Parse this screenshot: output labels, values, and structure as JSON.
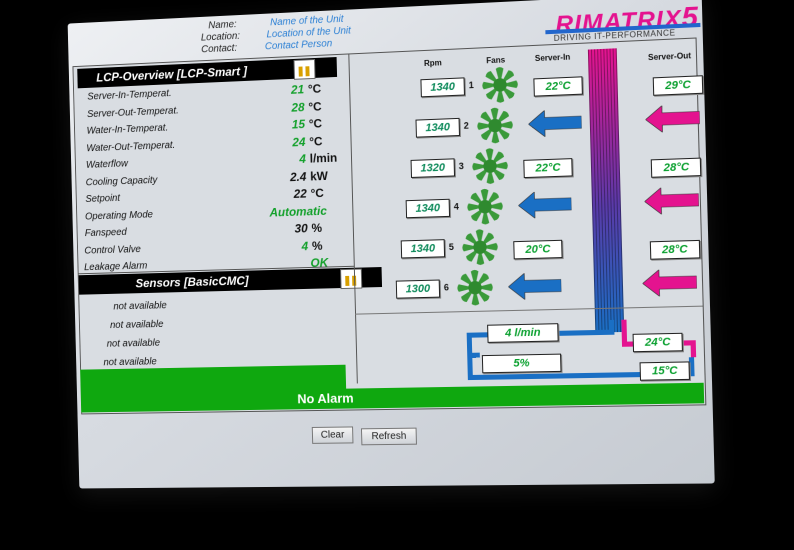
{
  "header": {
    "name_label": "Name:",
    "name_value": "Name of the Unit",
    "location_label": "Location:",
    "location_value": "Location of the Unit",
    "contact_label": "Contact:",
    "contact_value": "Contact Person",
    "logo_text": "RIMATRIX",
    "logo_suffix": "5",
    "tagline": "DRIVING IT-PERFORMANCE"
  },
  "overview": {
    "title": "LCP-Overview [LCP-Smart ]",
    "rows": [
      {
        "label": "Server-In-Temperat.",
        "value": "21",
        "unit": "°C",
        "color": "green"
      },
      {
        "label": "Server-Out-Temperat.",
        "value": "28",
        "unit": "°C",
        "color": "green"
      },
      {
        "label": "Water-In-Temperat.",
        "value": "15",
        "unit": "°C",
        "color": "green"
      },
      {
        "label": "Water-Out-Temperat.",
        "value": "24",
        "unit": "°C",
        "color": "green"
      },
      {
        "label": "Waterflow",
        "value": "4",
        "unit": "l/min",
        "color": "green"
      },
      {
        "label": "Cooling Capacity",
        "value": "2.4",
        "unit": "kW",
        "color": "black"
      },
      {
        "label": "Setpoint",
        "value": "22",
        "unit": "°C",
        "color": "black"
      },
      {
        "label": "Operating Mode",
        "value": "Automatic",
        "unit": "",
        "color": "green"
      },
      {
        "label": "Fanspeed",
        "value": "30",
        "unit": "%",
        "color": "black"
      },
      {
        "label": "Control Valve",
        "value": "4",
        "unit": "%",
        "color": "green"
      },
      {
        "label": "Leakage Alarm",
        "value": "OK",
        "unit": "",
        "color": "green"
      }
    ]
  },
  "sensors": {
    "title": "Sensors [BasicCMC]",
    "items": [
      "not available",
      "not available",
      "not available",
      "not available"
    ]
  },
  "diagram": {
    "col_rpm": "Rpm",
    "col_fans": "Fans",
    "col_server_in": "Server-In",
    "col_server_out": "Server-Out",
    "fans": [
      {
        "rpm": "1340",
        "index": "1"
      },
      {
        "rpm": "1340",
        "index": "2"
      },
      {
        "rpm": "1320",
        "index": "3"
      },
      {
        "rpm": "1340",
        "index": "4"
      },
      {
        "rpm": "1340",
        "index": "5"
      },
      {
        "rpm": "1300",
        "index": "6"
      }
    ],
    "server_in_temps": [
      "22°C",
      "22°C",
      "20°C"
    ],
    "server_out_temps": [
      "29°C",
      "28°C",
      "28°C"
    ],
    "waterflow": "4 l/min",
    "valve": "5%",
    "water_out": "24°C",
    "water_in": "15°C"
  },
  "status": {
    "alarm_text": "No Alarm"
  },
  "buttons": {
    "clear": "Clear",
    "refresh": "Refresh"
  },
  "colors": {
    "green": "#0fa80f",
    "value_green": "#12a02a",
    "blue": "#1a6fc4",
    "magenta": "#e4138f"
  }
}
